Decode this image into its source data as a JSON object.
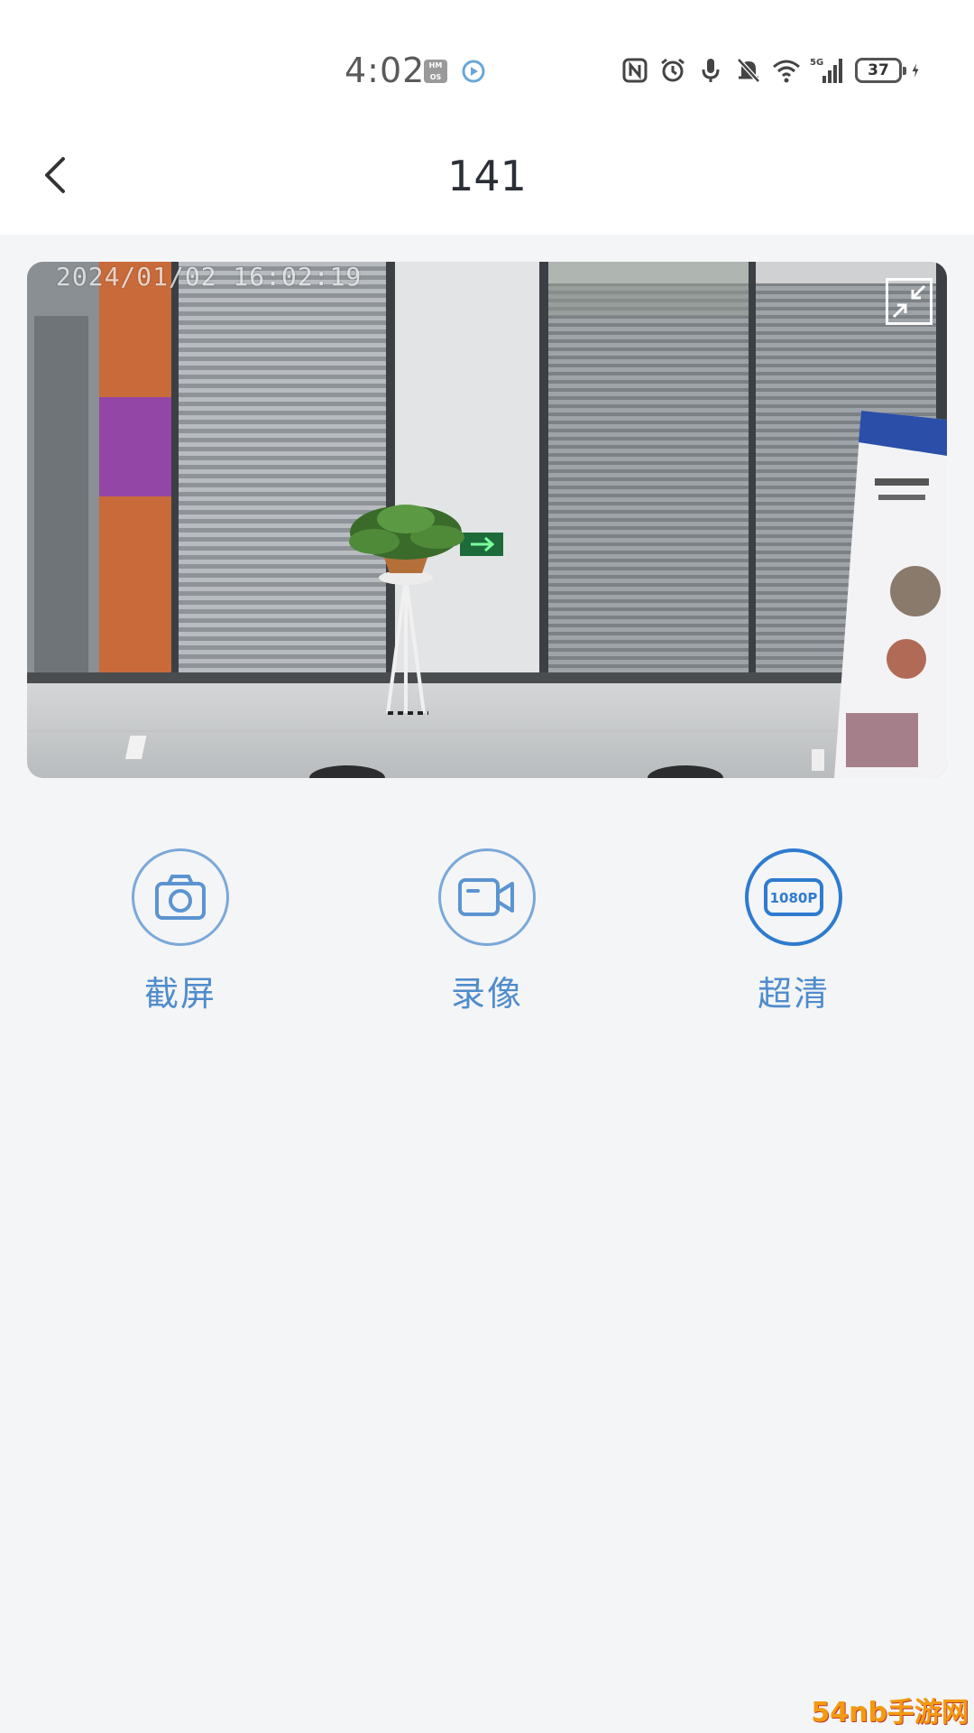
{
  "status_bar": {
    "time": "4:02",
    "hmos_badge": "HM OS",
    "icons": [
      "nfc-icon",
      "alarm-icon",
      "mic-icon",
      "mute-bell-icon",
      "wifi-icon",
      "signal-5g-icon"
    ],
    "signal_label": "5G",
    "battery": "37"
  },
  "header": {
    "title": "141",
    "back_icon": "chevron-left-icon"
  },
  "video": {
    "timestamp": "2024/01/02 16:02:19",
    "fullscreen_icon": "exit-fullscreen-icon"
  },
  "controls": [
    {
      "label": "截屏",
      "icon": "camera-icon"
    },
    {
      "label": "录像",
      "icon": "video-camera-icon"
    },
    {
      "label": "超清",
      "icon": "1080p-icon",
      "icon_text": "1080P"
    }
  ],
  "watermark": "54nb手游网",
  "colors": {
    "accent": "#4f8ccc",
    "accent_active": "#2e7bd0",
    "background": "#f4f5f6",
    "title": "#2b2f36"
  }
}
